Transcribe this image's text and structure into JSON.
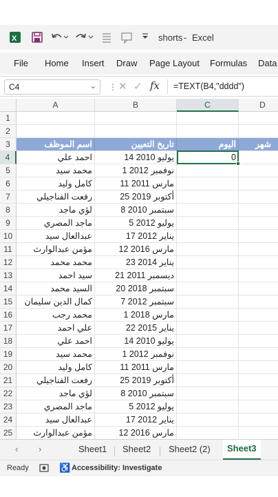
{
  "titlebar": {
    "filename": "shorts",
    "separator": "-",
    "app": "Excel",
    "icons": [
      "excel-logo-icon",
      "save-icon",
      "undo-icon",
      "redo-icon",
      "form-icon",
      "comment-icon",
      "customize-icon"
    ]
  },
  "menu": [
    "File",
    "Home",
    "Insert",
    "Draw",
    "Page Layout",
    "Formulas",
    "Data"
  ],
  "formula_bar": {
    "name_box": "C4",
    "fx": "fx",
    "formula": "=TEXT(B4,\"dddd\")"
  },
  "columns": [
    "A",
    "B",
    "C",
    "D"
  ],
  "rows": [
    "1",
    "2",
    "3",
    "4",
    "5",
    "6",
    "7",
    "8",
    "9",
    "10",
    "11",
    "12",
    "13",
    "14",
    "15",
    "16",
    "17",
    "18",
    "19",
    "20",
    "21",
    "22",
    "23",
    "24",
    "25"
  ],
  "headers": {
    "name": "اسم الموظف",
    "date": "تاريخ التعيين",
    "day": "اليوم",
    "month": "شهر"
  },
  "data_rows": [
    {
      "name": "احمد علي",
      "date": "14 يوليو 2010",
      "day": "0"
    },
    {
      "name": "محمد سيد",
      "date": "1 نوفمبر 2012",
      "day": ""
    },
    {
      "name": "كامل وليد",
      "date": "11 مارس 2011",
      "day": ""
    },
    {
      "name": "رفعت الفناجيلي",
      "date": "25 أكتوبر 2019",
      "day": ""
    },
    {
      "name": "لؤي ماجد",
      "date": "8 سبتمبر 2010",
      "day": ""
    },
    {
      "name": "ماجد المصري",
      "date": "5 يوليو 2012",
      "day": ""
    },
    {
      "name": "عبدالعال سيد",
      "date": "17 يناير 2012",
      "day": ""
    },
    {
      "name": "مؤمن عبدالوارث",
      "date": "12 مارس 2016",
      "day": ""
    },
    {
      "name": "محمد محمد",
      "date": "23 يناير 2014",
      "day": ""
    },
    {
      "name": "سيد احمد",
      "date": "21 ديسمبر 2011",
      "day": ""
    },
    {
      "name": "السيد محمد",
      "date": "20 سبتمبر 2018",
      "day": ""
    },
    {
      "name": "كمال الدين سليمان",
      "date": "7 سبتمبر 2012",
      "day": ""
    },
    {
      "name": "محمد رجب",
      "date": "1 مارس 2018",
      "day": ""
    },
    {
      "name": "علي احمد",
      "date": "22 يناير 2015",
      "day": ""
    },
    {
      "name": "احمد علي",
      "date": "14 يوليو 2010",
      "day": ""
    },
    {
      "name": "محمد سيد",
      "date": "1 نوفمبر 2012",
      "day": ""
    },
    {
      "name": "كامل وليد",
      "date": "11 مارس 2011",
      "day": ""
    },
    {
      "name": "رفعت الفناجيلي",
      "date": "25 أكتوبر 2019",
      "day": ""
    },
    {
      "name": "لؤي ماجد",
      "date": "8 سبتمبر 2010",
      "day": ""
    },
    {
      "name": "ماجد المصري",
      "date": "5 يوليو 2012",
      "day": ""
    },
    {
      "name": "عبدالعال سيد",
      "date": "17 يناير 2012",
      "day": ""
    },
    {
      "name": "مؤمن عبدالوارث",
      "date": "12 مارس 2016",
      "day": ""
    }
  ],
  "sheet_tabs": [
    "Sheet1",
    "Sheet2",
    "Sheet2 (2)",
    "Sheet3"
  ],
  "active_sheet": "Sheet3",
  "status": {
    "ready": "Ready",
    "accessibility": "Accessibility: Investigate"
  },
  "colors": {
    "excel_green": "#217346",
    "header_fill": "#8ea9d8"
  }
}
